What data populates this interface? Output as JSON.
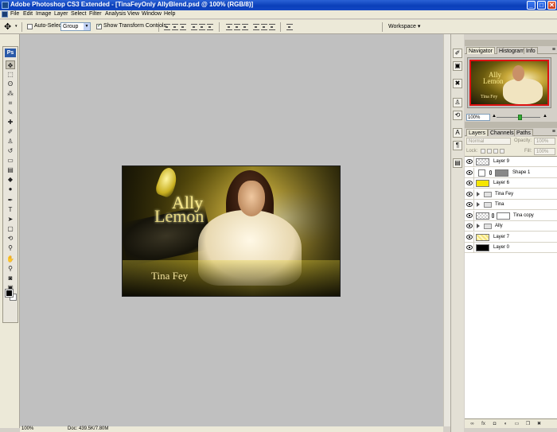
{
  "window": {
    "title": "Adobe Photoshop CS3 Extended - [TinaFeyOnly AllyBlend.psd @ 100% (RGB/8)]",
    "minimize": "_",
    "maximize": "□",
    "close": "✕"
  },
  "menu": [
    "File",
    "Edit",
    "Image",
    "Layer",
    "Select",
    "Filter",
    "Analysis",
    "View",
    "Window",
    "Help"
  ],
  "options_bar": {
    "auto_select_label": "Auto-Select:",
    "auto_select_checked": false,
    "auto_select_value": "Group",
    "show_transform_label": "Show Transform Controls",
    "show_transform_checked": true,
    "workspace_label": "Workspace ▾"
  },
  "toolbox": {
    "logo": "Ps",
    "tools": [
      {
        "name": "move-tool",
        "glyph": "✥",
        "active": true
      },
      {
        "name": "marquee-tool",
        "glyph": "⬚"
      },
      {
        "name": "lasso-tool",
        "glyph": "ʘ"
      },
      {
        "name": "magic-wand-tool",
        "glyph": "⁂"
      },
      {
        "name": "crop-tool",
        "glyph": "⌗"
      },
      {
        "name": "slice-tool",
        "glyph": "✎"
      },
      {
        "name": "healing-brush-tool",
        "glyph": "✚"
      },
      {
        "name": "brush-tool",
        "glyph": "✐"
      },
      {
        "name": "clone-stamp-tool",
        "glyph": "♙"
      },
      {
        "name": "history-brush-tool",
        "glyph": "↺"
      },
      {
        "name": "eraser-tool",
        "glyph": "▭"
      },
      {
        "name": "gradient-tool",
        "glyph": "▤"
      },
      {
        "name": "blur-tool",
        "glyph": "◆"
      },
      {
        "name": "dodge-tool",
        "glyph": "●"
      },
      {
        "name": "pen-tool",
        "glyph": "✒"
      },
      {
        "name": "type-tool",
        "glyph": "T"
      },
      {
        "name": "path-selection-tool",
        "glyph": "➤"
      },
      {
        "name": "shape-tool",
        "glyph": "▢"
      },
      {
        "name": "3d-rotate-tool",
        "glyph": "⟲"
      },
      {
        "name": "eyedropper-tool",
        "glyph": "⚲"
      },
      {
        "name": "hand-tool",
        "glyph": "✋"
      },
      {
        "name": "zoom-tool",
        "glyph": "⚲"
      },
      {
        "name": "quick-mask-tool",
        "glyph": "◙"
      },
      {
        "name": "screen-mode-tool",
        "glyph": "▣"
      }
    ],
    "foreground_color": "#000000",
    "background_color": "#ffffff"
  },
  "document": {
    "text_line1": "Ally",
    "text_line2": "Lemon",
    "text_caption": "Tina Fey"
  },
  "status_bar": {
    "zoom": "100%",
    "doc_info": "Doc: 439.5K/7.80M"
  },
  "navigator": {
    "tabs": [
      "Navigator",
      "Histogram",
      "Info"
    ],
    "active_tab": "Navigator",
    "zoom": "100%",
    "zoom_level_fraction": 0.55,
    "preview_text_line1": "Ally",
    "preview_text_line2": "Lemon",
    "preview_caption": "Tina Fey"
  },
  "layers_panel": {
    "tabs": [
      "Layers",
      "Channels",
      "Paths"
    ],
    "active_tab": "Layers",
    "blend_mode": "Normal",
    "opacity_label": "Opacity:",
    "opacity": "100%",
    "lock_label": "Lock:",
    "fill_label": "Fill:",
    "fill": "100%",
    "layers": [
      {
        "name": "Layer 9",
        "type": "layer",
        "thumb": "check",
        "visible": true
      },
      {
        "name": "Shape 1",
        "type": "shape",
        "thumb": "white",
        "mask": "grey",
        "visible": true
      },
      {
        "name": "Layer 6",
        "type": "layer",
        "thumb": "yellow",
        "visible": true
      },
      {
        "name": "Tina Fey",
        "type": "group",
        "visible": true
      },
      {
        "name": "Tina",
        "type": "group",
        "visible": true
      },
      {
        "name": "Tina copy",
        "type": "masked",
        "thumb": "check",
        "mask": "white",
        "visible": true
      },
      {
        "name": "Ally",
        "type": "group",
        "visible": true
      },
      {
        "name": "Layer 7",
        "type": "layer",
        "thumb": "yellowcheck",
        "visible": true
      },
      {
        "name": "Layer 0",
        "type": "layer",
        "thumb": "black",
        "visible": true
      }
    ],
    "bottom_icons": [
      "link-icon",
      "fx-icon",
      "mask-icon",
      "adjustment-icon",
      "folder-icon",
      "new-layer-icon",
      "trash-icon"
    ]
  },
  "panel_strip_icons": [
    "brush-preset-icon",
    "tool-preset-icon",
    "layer-comps-icon",
    "clone-source-icon",
    "character-icon",
    "paragraph-icon",
    "actions-icon"
  ]
}
